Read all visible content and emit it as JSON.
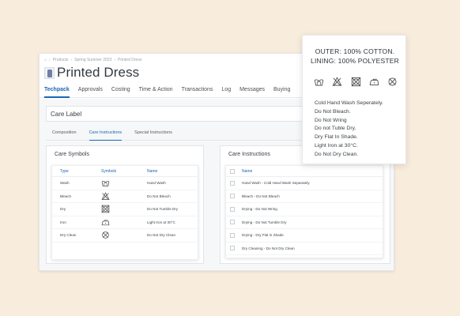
{
  "breadcrumb": [
    "Products",
    "Spring Summer 2023",
    "Printed Dress"
  ],
  "page_title": "Printed Dress",
  "tabs": [
    {
      "label": "Techpack",
      "active": true
    },
    {
      "label": "Approvals"
    },
    {
      "label": "Costing"
    },
    {
      "label": "Time & Action"
    },
    {
      "label": "Transactions"
    },
    {
      "label": "Log"
    },
    {
      "label": "Messages"
    },
    {
      "label": "Buying"
    }
  ],
  "care_label_title": "Care Label",
  "subtabs": [
    {
      "label": "Composition"
    },
    {
      "label": "Care Instructions",
      "active": true
    },
    {
      "label": "Special Instructions"
    }
  ],
  "care_symbols": {
    "title": "Care Symbols",
    "headers": {
      "type": "Type",
      "symbols": "Symbols",
      "name": "Name"
    },
    "rows": [
      {
        "type": "Wash",
        "icon": "hand-wash-icon",
        "name": "Hand Wash"
      },
      {
        "type": "Bleach",
        "icon": "do-not-bleach-icon",
        "name": "Do Not Bleach"
      },
      {
        "type": "Dry",
        "icon": "do-not-tumble-dry-icon",
        "name": "Do Not Tumble Dry"
      },
      {
        "type": "Iron",
        "icon": "iron-low-icon",
        "name": "Light Iron at 30°C"
      },
      {
        "type": "Dry Clean",
        "icon": "do-not-dry-clean-icon",
        "name": "Do Not Dry Clean"
      }
    ]
  },
  "care_instructions": {
    "title": "Care Instructions",
    "header_name": "Name",
    "rows": [
      "Hand Wash - Cold Hand Wash Separately",
      "Bleach - Do Not Bleach",
      "Drying - Do Not Wring",
      "Drying - Do Not Tumble Dry",
      "Drying - Dry Flat in Shade",
      "Dry Cleaning - Do Not Dry Clean"
    ]
  },
  "label_preview": {
    "heading_line1": "OUTER: 100% COTTON.",
    "heading_line2": "LINING: 100% POLYESTER",
    "icons": [
      "hand-wash-icon",
      "do-not-bleach-icon",
      "do-not-tumble-dry-icon",
      "iron-low-icon",
      "do-not-dry-clean-icon"
    ],
    "instructions": [
      "Cold Hand Wash Seperately.",
      "Do Not Bleach.",
      "Do Not Wring",
      "Do not Tuble Dry.",
      "Dry Flat In Shade.",
      "Light Iron at 30°C.",
      "Do Not Dry Clean."
    ]
  },
  "colors": {
    "accent": "#1a66b3",
    "background": "#f8ecdd"
  }
}
